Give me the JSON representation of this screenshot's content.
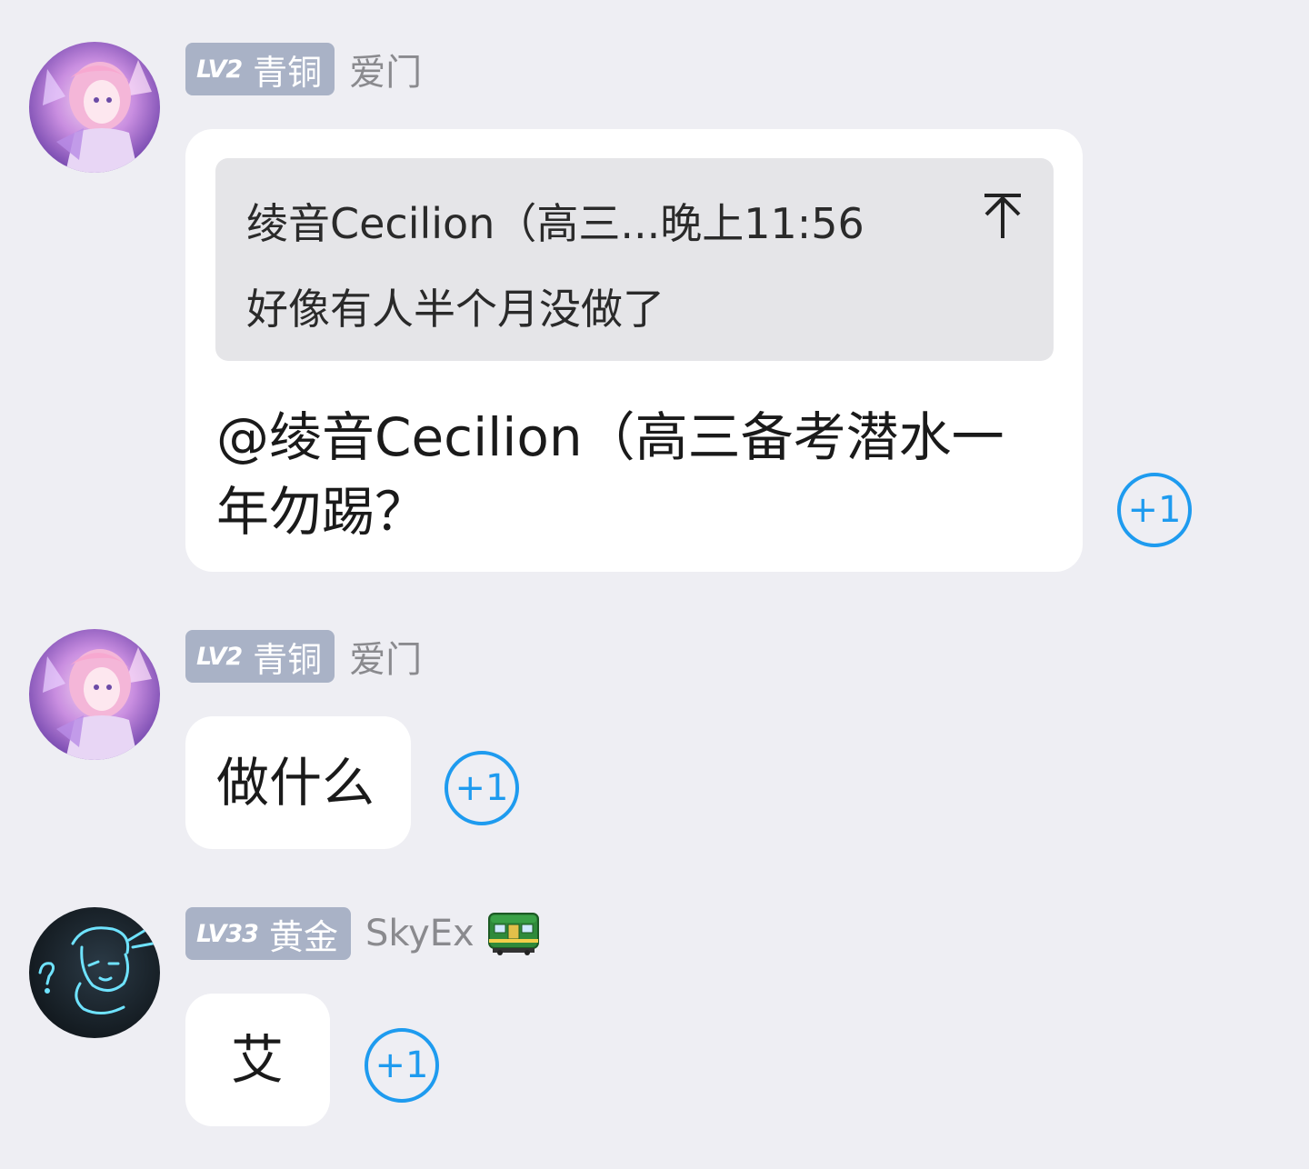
{
  "messages": [
    {
      "level": "LV2",
      "rank": "青铜",
      "nickname": "爱门",
      "avatar_icon": "anime-girl-avatar",
      "quote": {
        "header": "绫音Cecilion（高三...晚上11:56",
        "text": "好像有人半个月没做了",
        "jump_icon": "jump-to-top-icon"
      },
      "text": "@绫音Cecilion（高三备考潜水一年勿踢？",
      "text_line1": "@绫音Cecilion（高三备考潜水一",
      "text_line2": "年勿踢？",
      "plus_one": "+1"
    },
    {
      "level": "LV2",
      "rank": "青铜",
      "nickname": "爱门",
      "avatar_icon": "anime-girl-avatar",
      "text": "做什么",
      "plus_one": "+1"
    },
    {
      "level": "LV33",
      "rank": "黄金",
      "nickname": "SkyEx",
      "avatar_icon": "neon-sketch-avatar",
      "extra_icon": "green-train-icon",
      "text": "艾",
      "plus_one": "+1"
    }
  ],
  "colors": {
    "background": "#eeeef3",
    "badge": "#a9b2c6",
    "accent": "#1e9bef",
    "bubble": "#ffffff",
    "quote_bg": "#e5e5e8"
  }
}
